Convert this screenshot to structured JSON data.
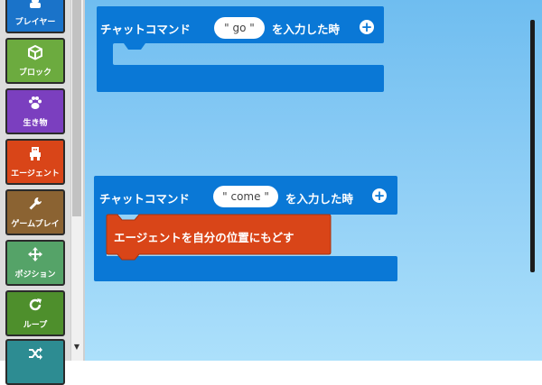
{
  "sidebar": {
    "categories": [
      {
        "label": "プレイヤー",
        "icon": "player-icon",
        "color": "#1a73c9"
      },
      {
        "label": "ブロック",
        "icon": "cube-icon",
        "color": "#6cab3f"
      },
      {
        "label": "生き物",
        "icon": "paw-icon",
        "color": "#7b3fbf"
      },
      {
        "label": "エージェント",
        "icon": "agent-icon",
        "color": "#d94518"
      },
      {
        "label": "ゲームプレイ",
        "icon": "wrench-icon",
        "color": "#8b6332"
      },
      {
        "label": "ポジション",
        "icon": "move-icon",
        "color": "#55a368"
      },
      {
        "label": "ループ",
        "icon": "loop-icon",
        "color": "#4e8f2c"
      },
      {
        "label": "",
        "icon": "shuffle-icon",
        "color": "#2d8c92"
      }
    ]
  },
  "workspace": {
    "event_color": "#0a78d6",
    "agent_color": "#d94518",
    "blocks": [
      {
        "prefix": "チャットコマンド",
        "value": "\" go \"",
        "suffix": "を入力した時",
        "body": []
      },
      {
        "prefix": "チャットコマンド",
        "value": "\" come \"",
        "suffix": "を入力した時",
        "body": [
          "エージェントを自分の位置にもどす"
        ]
      }
    ]
  }
}
